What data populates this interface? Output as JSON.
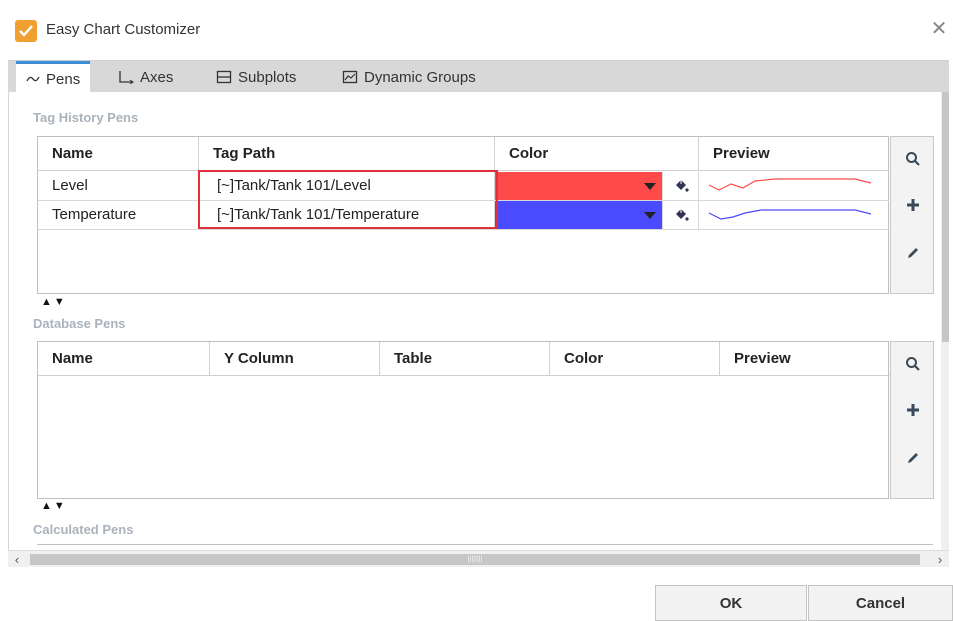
{
  "window": {
    "title": "Easy Chart Customizer",
    "close_glyph": "✕"
  },
  "tabs": [
    {
      "label": "Pens",
      "icon": "wave-icon",
      "active": true
    },
    {
      "label": "Axes",
      "icon": "axes-icon",
      "active": false
    },
    {
      "label": "Subplots",
      "icon": "subplots-icon",
      "active": false
    },
    {
      "label": "Dynamic Groups",
      "icon": "chart-box-icon",
      "active": false
    }
  ],
  "tag_history": {
    "label": "Tag History Pens",
    "columns": [
      "Name",
      "Tag Path",
      "Color",
      "Preview"
    ],
    "rows": [
      {
        "name": "Level",
        "tag_path": "[~]Tank/Tank 101/Level",
        "color": "#ff4a4a"
      },
      {
        "name": "Temperature",
        "tag_path": "[~]Tank/Tank 101/Temperature",
        "color": "#4a4aff"
      }
    ]
  },
  "database": {
    "label": "Database Pens",
    "columns": [
      "Name",
      "Y Column",
      "Table",
      "Color",
      "Preview"
    ]
  },
  "calculated": {
    "label": "Calculated Pens"
  },
  "reorder_arrows": "▲▼",
  "footer": {
    "ok_label": "OK",
    "cancel_label": "Cancel"
  },
  "colors": {
    "accent": "#3c8fd6",
    "highlight": "#e0303a",
    "section_label": "#aab3bc"
  }
}
